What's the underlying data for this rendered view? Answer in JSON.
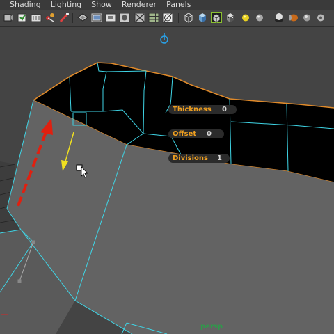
{
  "menu": [
    "Shading",
    "Lighting",
    "Show",
    "Renderer",
    "Panels"
  ],
  "toolbar_icons": [
    "select-camera-icon",
    "lock-camera-icon",
    "camera-attributes-icon",
    "bookmark-icon",
    "image-plane-icon",
    "film-gate-icon",
    "resolution-gate-icon",
    "gate-mask-icon",
    "field-chart-icon",
    "safe-action-icon",
    "grid-icon",
    "wireframe-icon",
    "smooth-shade-icon",
    "wireframe-on-shaded-icon",
    "textured-icon",
    "use-all-lights-icon",
    "shadows-icon",
    "ambient-occlusion-icon",
    "motion-blur-icon",
    "antialiasing-icon"
  ],
  "hud": {
    "thickness_label": "Thickness",
    "thickness_value": "0",
    "offset_label": "Offset",
    "offset_value": "0",
    "divisions_label": "Divisions",
    "divisions_value": "1"
  },
  "camera_name": "persp",
  "colors": {
    "wire": "#3fd5e6",
    "edge_highlight": "#e08a2a",
    "hud_label": "#f0a020",
    "hud_bg": "#2b2b2b",
    "drag_arrow": "#e02010",
    "guide_arrow": "#f0e020",
    "manipulator": "#2aa0e6",
    "camera_label": "#2e9a4a"
  }
}
